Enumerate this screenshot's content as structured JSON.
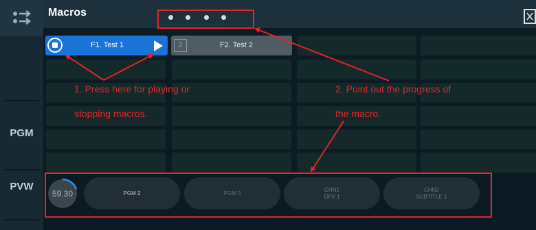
{
  "header": {
    "title": "Macros"
  },
  "sidebar": {
    "pgm_label": "PGM",
    "pvw_label": "PVW"
  },
  "macros": [
    {
      "number": "",
      "label": "F1. Test 1",
      "state": "active"
    },
    {
      "number": "2",
      "label": "F2. Test 2",
      "state": "inactive"
    }
  ],
  "pvw": {
    "timer": "59.30",
    "progress": 0.2,
    "sources": [
      {
        "line1": "PGM 2",
        "line2": ""
      },
      {
        "line1": "PGM 3",
        "line2": ""
      },
      {
        "line1": "CHN1",
        "line2": "GFX 1"
      },
      {
        "line1": "CHN2",
        "line2": "SUBTITLE 1"
      }
    ]
  },
  "annotations": {
    "note1_line1": "1. Press here for playing or",
    "note1_line2": "stopping macros.",
    "note2_line1": "2. Point out the progress of",
    "note2_line2": "the macro."
  },
  "colors": {
    "accent_blue": "#1a73d6",
    "annotation_red": "#e8212b",
    "progress_blue": "#2d8be0"
  }
}
